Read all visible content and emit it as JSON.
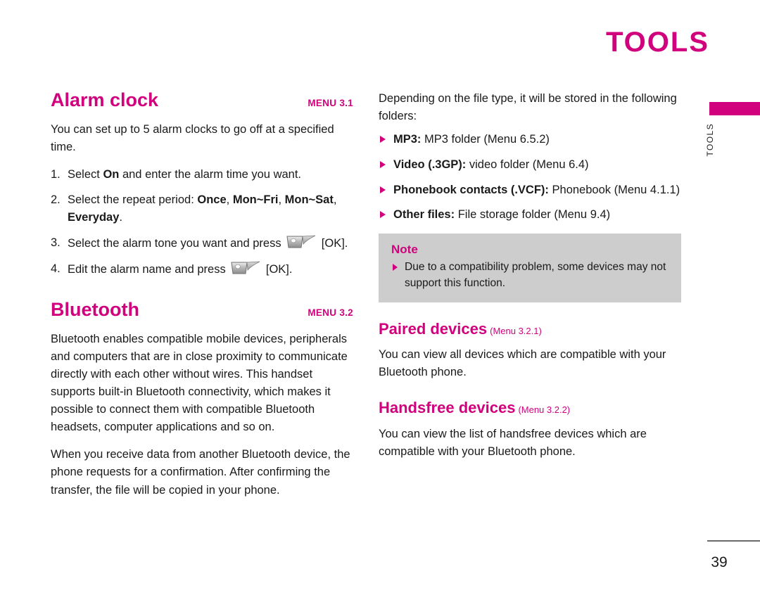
{
  "page": {
    "title": "TOOLS",
    "thumb_tab_label": "TOOLS",
    "number": "39",
    "accent_color": "#d1017d",
    "note_bg_color": "#cdcdcd"
  },
  "left_column": {
    "alarm": {
      "heading": "Alarm clock",
      "menu_ref": "MENU 3.1",
      "intro": "You can set up to 5 alarm clocks to go off at a specified time.",
      "steps": [
        {
          "num": "1.",
          "pre": "Select ",
          "bold": "On",
          "post": " and enter the alarm time you want."
        },
        {
          "num": "2.",
          "pre": "Select the repeat period: ",
          "bold1": "Once",
          "sep1": ", ",
          "bold2": "Mon~Fri",
          "sep2": ", ",
          "bold3": "Mon~Sat",
          "sep3": ", ",
          "bold4": "Everyday",
          "post": "."
        },
        {
          "num": "3.",
          "pre": "Select the alarm tone you want and press ",
          "icon": "soft-key-icon",
          "post": " [OK]."
        },
        {
          "num": "4.",
          "pre": "Edit the alarm name and press ",
          "icon": "soft-key-icon",
          "post": " [OK]."
        }
      ]
    },
    "bluetooth": {
      "heading": "Bluetooth",
      "menu_ref": "MENU 3.2",
      "paragraph_1": "Bluetooth enables compatible mobile devices, peripherals and computers that are in close proximity to communicate directly with each other without wires. This handset supports built-in Bluetooth connectivity, which makes it possible to connect them with compatible Bluetooth headsets, computer applications and so on.",
      "paragraph_2": "When you receive data from another Bluetooth device, the phone requests for a confirmation. After confirming the transfer, the file will be copied in your phone."
    }
  },
  "right_column": {
    "intro": "Depending on the file type, it will be stored in the following folders:",
    "folder_items": [
      {
        "bold": "MP3:",
        "text": " MP3 folder (Menu 6.5.2)"
      },
      {
        "bold": "Video (.3GP):",
        "text": " video folder (Menu 6.4)"
      },
      {
        "bold": "Phonebook contacts (.VCF):",
        "text": " Phonebook (Menu 4.1.1)"
      },
      {
        "bold": "Other files:",
        "text": " File storage folder (Menu 9.4)"
      }
    ],
    "note": {
      "title": "Note",
      "items": [
        "Due to a compatibility problem, some devices may not support this function."
      ]
    },
    "paired_devices": {
      "heading": "Paired devices",
      "menu_ref": "(Menu 3.2.1)",
      "body": "You can view all devices which are compatible with your Bluetooth phone."
    },
    "handsfree_devices": {
      "heading": "Handsfree devices",
      "menu_ref": "(Menu 3.2.2)",
      "body": "You can view the list of handsfree devices which are compatible with your Bluetooth phone."
    }
  }
}
